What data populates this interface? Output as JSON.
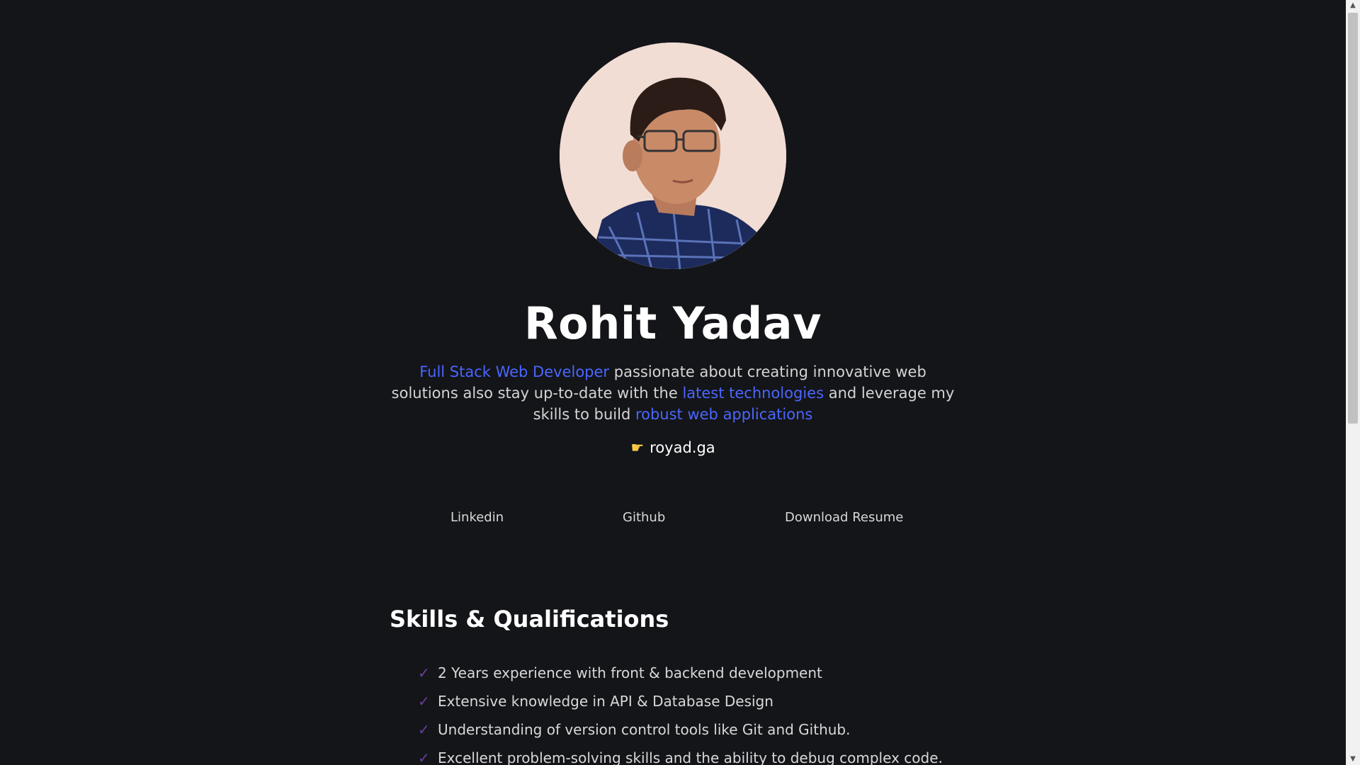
{
  "profile": {
    "name": "Rohit Yadav",
    "photo_alt": "profile photo"
  },
  "bio": {
    "part1_highlight": "Full Stack Web Developer",
    "part2": " passionate about creating innovative web solutions also stay up-to-date with the ",
    "part3_highlight": "latest technologies",
    "part4": " and leverage my skills to build ",
    "part5_highlight": "robust web applications"
  },
  "site": {
    "icon": "pointing-hand-icon",
    "label": "royad.ga"
  },
  "links": {
    "linkedin": "Linkedin",
    "github": "Github",
    "resume": "Download Resume"
  },
  "skills": {
    "title": "Skills & Qualifications",
    "items": [
      "2 Years experience with front & backend development",
      "Extensive knowledge in API & Database Design",
      "Understanding of version control tools like Git and Github.",
      "Excellent problem-solving skills and the ability to debug complex code."
    ]
  },
  "colors": {
    "background": "#141518",
    "accent": "#4a66ff",
    "check": "#6b3fa0"
  }
}
